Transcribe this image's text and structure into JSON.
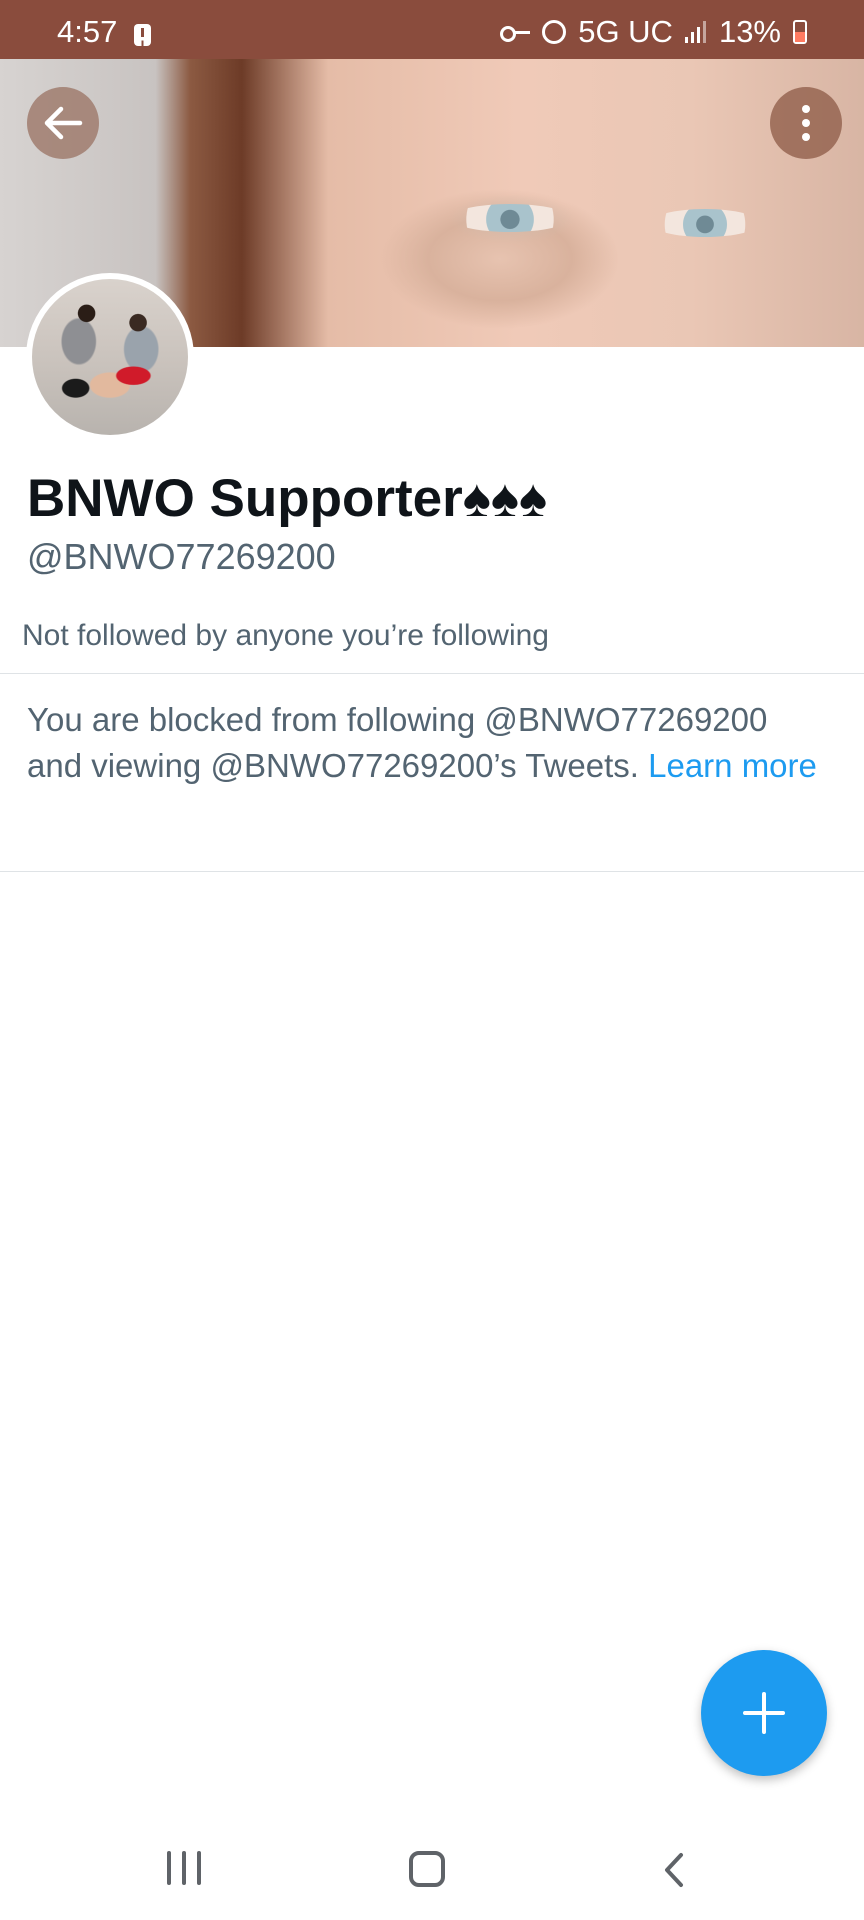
{
  "status_bar": {
    "time": "4:57",
    "network": "5G UC",
    "battery": "13%"
  },
  "profile": {
    "display_name": "BNWO Supporter♠♠♠",
    "handle": "@BNWO77269200",
    "followed_by_text": "Not followed by anyone you’re following"
  },
  "notice": {
    "text": "You are blocked from following @BNWO77269200 and viewing @BNWO77269200’s Tweets. ",
    "link_label": "Learn more"
  },
  "colors": {
    "accent": "#1d9bf0",
    "status_bar": "#8a4c3d",
    "secondary_text": "#536471"
  },
  "icons": {
    "back": "arrow-left-icon",
    "more": "more-vertical-icon",
    "compose": "plus-icon",
    "nav_recents": "recents-icon",
    "nav_home": "home-icon",
    "nav_back": "chevron-left-icon"
  }
}
